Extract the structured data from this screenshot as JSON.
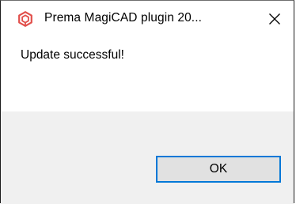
{
  "window": {
    "title": "Prema MagiCAD plugin 20...",
    "app_icon": "prema-logo-icon",
    "close_icon": "close-icon",
    "accent_color": "#e2504c"
  },
  "dialog": {
    "message": "Update successful!"
  },
  "footer": {
    "ok_label": "OK",
    "button_border_color": "#0078d7"
  }
}
